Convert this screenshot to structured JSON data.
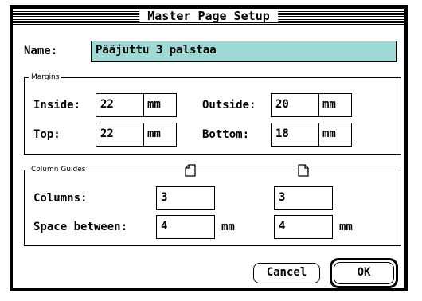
{
  "dialog": {
    "title": "Master Page Setup"
  },
  "name": {
    "label": "Name:",
    "value": "Pääjuttu 3 palstaa"
  },
  "margins": {
    "group_title": "Margins",
    "inside_label": "Inside:",
    "inside_value": "22",
    "outside_label": "Outside:",
    "outside_value": "20",
    "top_label": "Top:",
    "top_value": "22",
    "bottom_label": "Bottom:",
    "bottom_value": "18",
    "unit": "mm"
  },
  "column_guides": {
    "group_title": "Column Guides",
    "columns_label": "Columns:",
    "left_page_columns": "3",
    "right_page_columns": "3",
    "space_label": "Space between:",
    "left_page_space": "4",
    "right_page_space": "4",
    "unit": "mm",
    "left_page_icon": "left-page-icon",
    "right_page_icon": "right-page-icon"
  },
  "buttons": {
    "cancel": "Cancel",
    "ok": "OK"
  },
  "colors": {
    "selection": "#9fd9d6"
  }
}
